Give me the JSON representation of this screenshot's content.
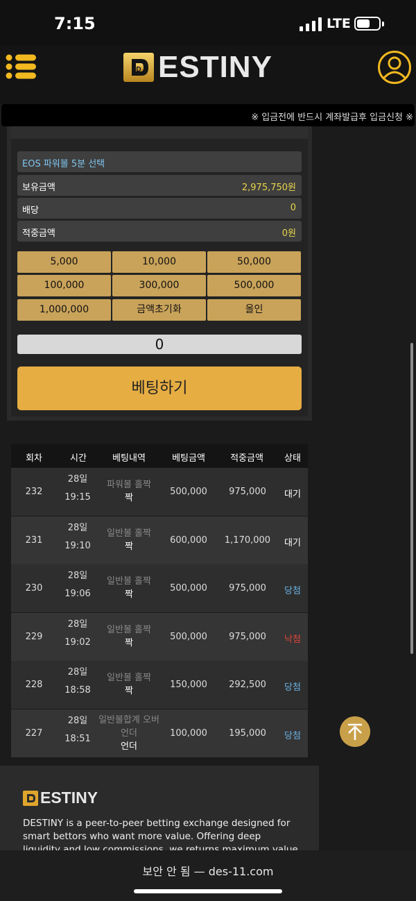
{
  "status_bar": {
    "time": "7:15",
    "network": "LTE"
  },
  "header": {
    "brand": "ESTINY",
    "brand_letter": "D"
  },
  "ticker": {
    "text": "※ 입금전에 반드시 계좌발급후 입금신청 ※"
  },
  "bet_panel": {
    "game": "EOS 파워볼 5분 선택",
    "balance_label": "보유금액",
    "balance_value": "2,975,750원",
    "odds_label": "배당",
    "odds_value": "0",
    "payout_label": "적중금액",
    "payout_value": "0원",
    "chips": [
      "5,000",
      "10,000",
      "50,000",
      "100,000",
      "300,000",
      "500,000",
      "1,000,000",
      "금액초기화",
      "올인"
    ],
    "amount": "0",
    "bet_button": "베팅하기"
  },
  "history": {
    "headers": [
      "회차",
      "시간",
      "베팅내역",
      "베팅금액",
      "적중금액",
      "상태"
    ],
    "rows": [
      {
        "round": "232",
        "time": "28일 19:15",
        "game": "파워볼 홀짝",
        "pick": "짝",
        "amount": "500,000",
        "payout": "975,000",
        "status": "대기",
        "status_type": "wait"
      },
      {
        "round": "231",
        "time": "28일 19:10",
        "game": "일반볼 홀짝",
        "pick": "짝",
        "amount": "600,000",
        "payout": "1,170,000",
        "status": "대기",
        "status_type": "wait"
      },
      {
        "round": "230",
        "time": "28일 19:06",
        "game": "일반볼 홀짝",
        "pick": "짝",
        "amount": "500,000",
        "payout": "975,000",
        "status": "당첨",
        "status_type": "win"
      },
      {
        "round": "229",
        "time": "28일 19:02",
        "game": "일반볼 홀짝",
        "pick": "짝",
        "amount": "500,000",
        "payout": "975,000",
        "status": "낙첨",
        "status_type": "lose"
      },
      {
        "round": "228",
        "time": "28일 18:58",
        "game": "일반볼 홀짝",
        "pick": "짝",
        "amount": "150,000",
        "payout": "292,500",
        "status": "당첨",
        "status_type": "win"
      },
      {
        "round": "227",
        "time": "28일 18:51",
        "game": "일반볼합계 오버언더",
        "pick": "언더",
        "amount": "100,000",
        "payout": "195,000",
        "status": "당첨",
        "status_type": "win"
      }
    ]
  },
  "footer": {
    "brand": "ESTINY",
    "brand_letter": "D",
    "description": "DESTINY is a peer-to-peer betting exchange designed for smart bettors who want more value. Offering deep liquidity and low commissions, we returns maximum value to bettors."
  },
  "browser": {
    "url": "보안 안 됨 — des-11.com"
  },
  "colors": {
    "gold": "#c9a35a",
    "accent": "#e6ad42",
    "win": "#6ab0e0",
    "lose": "#e0453a",
    "highlight": "#e8d64a"
  }
}
